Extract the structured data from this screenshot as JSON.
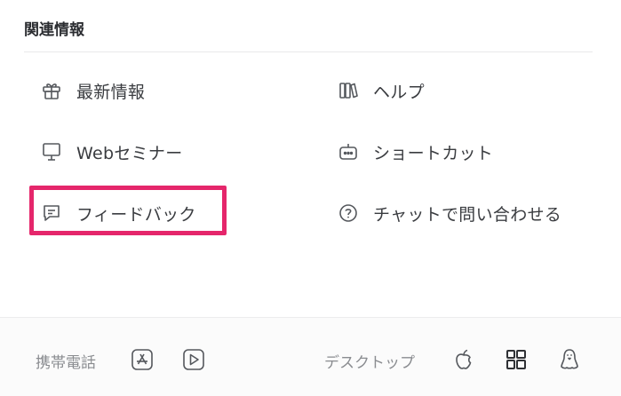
{
  "section": {
    "title": "関連情報"
  },
  "links": [
    {
      "label": "最新情報",
      "icon": "gift-icon"
    },
    {
      "label": "ヘルプ",
      "icon": "books-icon"
    },
    {
      "label": "Webセミナー",
      "icon": "presentation-screen-icon"
    },
    {
      "label": "ショートカット",
      "icon": "keyboard-robot-icon"
    },
    {
      "label": "フィードバック",
      "icon": "chat-bubble-icon"
    },
    {
      "label": "チャットで問い合わせる",
      "icon": "question-circle-icon"
    }
  ],
  "footer": {
    "mobile_label": "携帯電話",
    "desktop_label": "デスクトップ",
    "mobile_icons": [
      "app-store-icon",
      "google-play-icon"
    ],
    "desktop_icons": [
      "apple-icon",
      "windows-icon",
      "linux-icon"
    ]
  },
  "colors": {
    "highlight": "#e5266b",
    "text": "#3a3c40",
    "muted": "#8a8c90"
  }
}
